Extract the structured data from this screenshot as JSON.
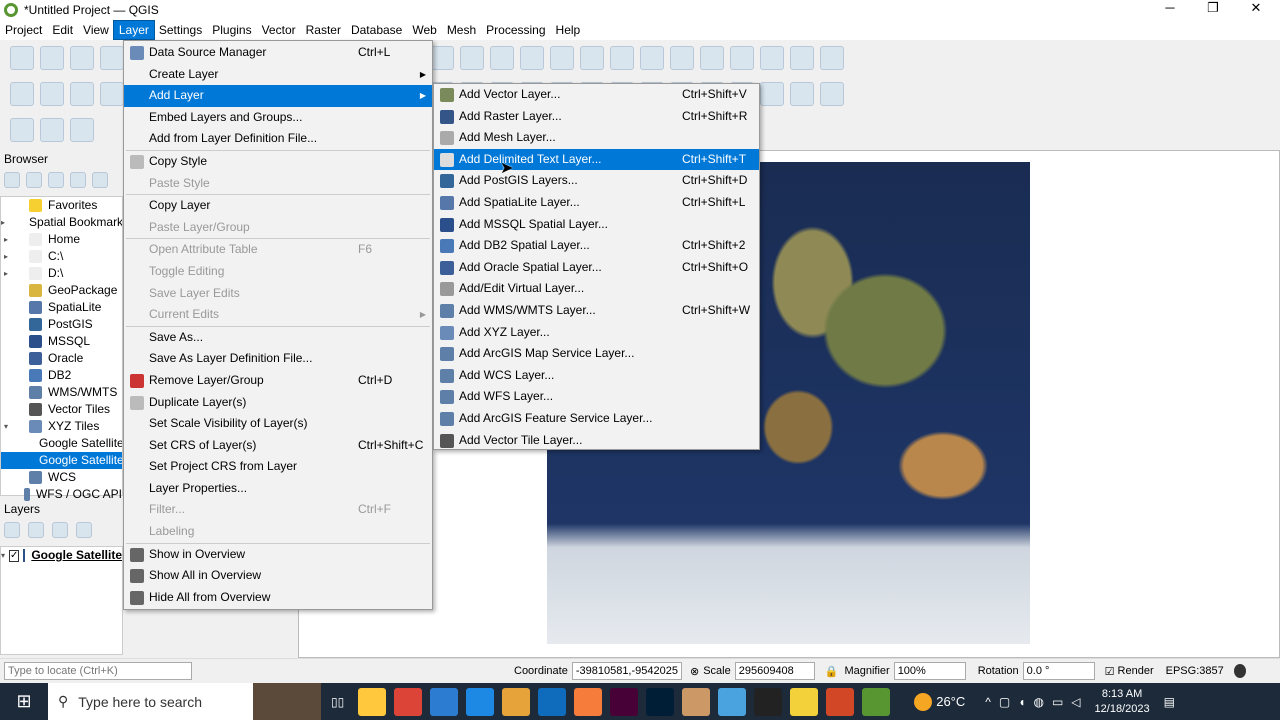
{
  "window": {
    "title": "*Untitled Project — QGIS",
    "minimize": "─",
    "restore": "❐",
    "close": "✕"
  },
  "menubar": [
    "Project",
    "Edit",
    "View",
    "Layer",
    "Settings",
    "Plugins",
    "Vector",
    "Raster",
    "Database",
    "Web",
    "Mesh",
    "Processing",
    "Help"
  ],
  "browser": {
    "title": "Browser",
    "items": [
      {
        "label": "Favorites",
        "color": "#f5d030",
        "arrow": ""
      },
      {
        "label": "Spatial Bookmarks",
        "color": "#ccd",
        "arrow": "▸"
      },
      {
        "label": "Home",
        "color": "#eee",
        "arrow": "▸"
      },
      {
        "label": "C:\\",
        "color": "#eee",
        "arrow": "▸"
      },
      {
        "label": "D:\\",
        "color": "#eee",
        "arrow": "▸"
      },
      {
        "label": "GeoPackage",
        "color": "#d9b640",
        "arrow": ""
      },
      {
        "label": "SpatiaLite",
        "color": "#5577aa",
        "arrow": ""
      },
      {
        "label": "PostGIS",
        "color": "#336699",
        "arrow": ""
      },
      {
        "label": "MSSQL",
        "color": "#2b4f8a",
        "arrow": ""
      },
      {
        "label": "Oracle",
        "color": "#3d5f99",
        "arrow": ""
      },
      {
        "label": "DB2",
        "color": "#4a79b8",
        "arrow": ""
      },
      {
        "label": "WMS/WMTS",
        "color": "#5d7fa8",
        "arrow": ""
      },
      {
        "label": "Vector Tiles",
        "color": "#555",
        "arrow": ""
      },
      {
        "label": "XYZ Tiles",
        "color": "#6a8ab8",
        "arrow": "▾"
      },
      {
        "label": "Google Satellite",
        "color": "#6a8ab8",
        "arrow": "",
        "indent": true
      },
      {
        "label": "Google Satellite",
        "color": "#6a8ab8",
        "arrow": "",
        "indent": true,
        "selected": true
      },
      {
        "label": "WCS",
        "color": "#5d7fa8",
        "arrow": ""
      },
      {
        "label": "WFS / OGC API",
        "color": "#5d7fa8",
        "arrow": ""
      }
    ]
  },
  "layers": {
    "title": "Layers",
    "items": [
      {
        "label": "Google Satellite",
        "checked": true
      }
    ]
  },
  "layer_menu": [
    {
      "label": "Data Source Manager",
      "shortcut": "Ctrl+L",
      "icon": "#6a8ab8"
    },
    {
      "label": "Create Layer",
      "submenu": true
    },
    {
      "label": "Add Layer",
      "submenu": true,
      "highlight": true
    },
    {
      "label": "Embed Layers and Groups..."
    },
    {
      "label": "Add from Layer Definition File..."
    },
    {
      "sep": true
    },
    {
      "label": "Copy Style",
      "icon": "#bbb"
    },
    {
      "label": "Paste Style",
      "disabled": true
    },
    {
      "sep": true
    },
    {
      "label": "Copy Layer"
    },
    {
      "label": "Paste Layer/Group",
      "disabled": true
    },
    {
      "sep": true
    },
    {
      "label": "Open Attribute Table",
      "shortcut": "F6",
      "disabled": true
    },
    {
      "label": "Toggle Editing",
      "disabled": true
    },
    {
      "label": "Save Layer Edits",
      "disabled": true
    },
    {
      "label": "Current Edits",
      "disabled": true,
      "submenu": true
    },
    {
      "sep": true
    },
    {
      "label": "Save As..."
    },
    {
      "label": "Save As Layer Definition File..."
    },
    {
      "label": "Remove Layer/Group",
      "shortcut": "Ctrl+D",
      "icon": "#c33"
    },
    {
      "label": "Duplicate Layer(s)",
      "icon": "#bbb"
    },
    {
      "label": "Set Scale Visibility of Layer(s)"
    },
    {
      "label": "Set CRS of Layer(s)",
      "shortcut": "Ctrl+Shift+C"
    },
    {
      "label": "Set Project CRS from Layer"
    },
    {
      "label": "Layer Properties..."
    },
    {
      "label": "Filter...",
      "shortcut": "Ctrl+F",
      "disabled": true
    },
    {
      "label": "Labeling",
      "disabled": true
    },
    {
      "sep": true
    },
    {
      "label": "Show in Overview",
      "icon": "#666"
    },
    {
      "label": "Show All in Overview",
      "icon": "#666"
    },
    {
      "label": "Hide All from Overview",
      "icon": "#666"
    }
  ],
  "add_layer_menu": [
    {
      "label": "Add Vector Layer...",
      "shortcut": "Ctrl+Shift+V",
      "icon": "#7a8a5a"
    },
    {
      "label": "Add Raster Layer...",
      "shortcut": "Ctrl+Shift+R",
      "icon": "#335588"
    },
    {
      "label": "Add Mesh Layer...",
      "icon": "#aaa"
    },
    {
      "label": "Add Delimited Text Layer...",
      "shortcut": "Ctrl+Shift+T",
      "icon": "#ddd",
      "highlight": true
    },
    {
      "label": "Add PostGIS Layers...",
      "shortcut": "Ctrl+Shift+D",
      "icon": "#336699"
    },
    {
      "label": "Add SpatiaLite Layer...",
      "shortcut": "Ctrl+Shift+L",
      "icon": "#5577aa"
    },
    {
      "label": "Add MSSQL Spatial Layer...",
      "icon": "#2b4f8a"
    },
    {
      "label": "Add DB2 Spatial Layer...",
      "shortcut": "Ctrl+Shift+2",
      "icon": "#4a79b8"
    },
    {
      "label": "Add Oracle Spatial Layer...",
      "shortcut": "Ctrl+Shift+O",
      "icon": "#3d5f99"
    },
    {
      "label": "Add/Edit Virtual Layer...",
      "icon": "#999"
    },
    {
      "label": "Add WMS/WMTS Layer...",
      "shortcut": "Ctrl+Shift+W",
      "icon": "#5d7fa8"
    },
    {
      "label": "Add XYZ Layer...",
      "icon": "#6a8ab8"
    },
    {
      "label": "Add ArcGIS Map Service Layer...",
      "icon": "#5d7fa8"
    },
    {
      "label": "Add WCS Layer...",
      "icon": "#5d7fa8"
    },
    {
      "label": "Add WFS Layer...",
      "icon": "#5d7fa8"
    },
    {
      "label": "Add ArcGIS Feature Service Layer...",
      "icon": "#5d7fa8"
    },
    {
      "label": "Add Vector Tile Layer...",
      "icon": "#555"
    }
  ],
  "statusbar": {
    "locate_placeholder": "Type to locate (Ctrl+K)",
    "coordinate_label": "Coordinate",
    "coordinate": "-39810581,-9542025",
    "scale_label": "Scale",
    "scale": "295609408",
    "magnifier_label": "Magnifier",
    "magnifier": "100%",
    "rotation_label": "Rotation",
    "rotation": "0.0 °",
    "render_label": "Render",
    "render_checked": true,
    "crs": "EPSG:3857"
  },
  "taskbar": {
    "search_placeholder": "Type here to search",
    "weather": "26°C",
    "time": "8:13 AM",
    "date": "12/18/2023",
    "apps": [
      "#ffc83d",
      "#db4437",
      "#2c7cd1",
      "#1e88e5",
      "#e6a33a",
      "#0f6cbd",
      "#f57c3b",
      "#470137",
      "#001e36",
      "#c96",
      "#4aa3df",
      "#222",
      "#f2d13a",
      "#d24726",
      "#589632"
    ]
  }
}
